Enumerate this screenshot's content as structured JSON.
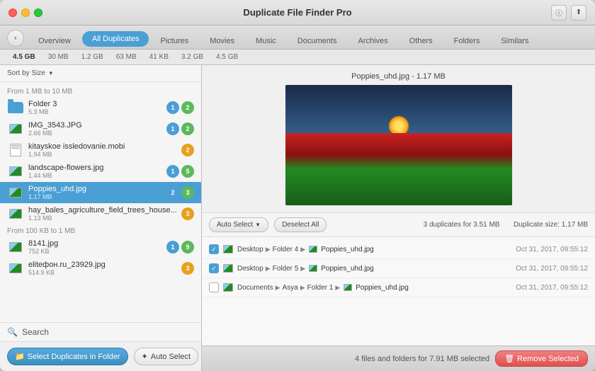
{
  "window": {
    "title": "Duplicate File Finder Pro"
  },
  "titlebar": {
    "back_btn": "‹",
    "info_btn": "ⓘ",
    "share_btn": "⬆"
  },
  "tabs": [
    {
      "id": "overview",
      "label": "Overview",
      "active": false
    },
    {
      "id": "all-duplicates",
      "label": "All Duplicates",
      "active": true
    },
    {
      "id": "pictures",
      "label": "Pictures",
      "active": false
    },
    {
      "id": "movies",
      "label": "Movies",
      "active": false
    },
    {
      "id": "music",
      "label": "Music",
      "active": false
    },
    {
      "id": "documents",
      "label": "Documents",
      "active": false
    },
    {
      "id": "archives",
      "label": "Archives",
      "active": false
    },
    {
      "id": "others",
      "label": "Others",
      "active": false
    },
    {
      "id": "folders",
      "label": "Folders",
      "active": false
    },
    {
      "id": "similars",
      "label": "Similars",
      "active": false
    }
  ],
  "subtabs": [
    {
      "label": "4.5 GB"
    },
    {
      "label": "30 MB"
    },
    {
      "label": "1.2 GB"
    },
    {
      "label": "63 MB"
    },
    {
      "label": "41 KB"
    },
    {
      "label": "3.2 GB"
    },
    {
      "label": "4.5 GB"
    }
  ],
  "sort_row": {
    "label": "Sort by Size",
    "arrow": "▼"
  },
  "section1_header": "From 1 MB to 10 MB",
  "file_items_section1": [
    {
      "name": "Folder 3",
      "size": "5.3 MB",
      "type": "folder",
      "badge1": "1",
      "badge2": "2"
    },
    {
      "name": "IMG_3543.JPG",
      "size": "2.66 MB",
      "type": "image",
      "badge1": "1",
      "badge2": "2"
    },
    {
      "name": "kitayskoe issledovanie.mobi",
      "size": "1.94 MB",
      "type": "doc",
      "badge1": "2",
      "badge2": null
    },
    {
      "name": "landscape-flowers.jpg",
      "size": "1.44 MB",
      "type": "image",
      "badge1": "1",
      "badge2": "5"
    },
    {
      "name": "Poppies_uhd.jpg",
      "size": "1.17 MB",
      "type": "image",
      "badge1": "2",
      "badge2": "3",
      "selected": true
    },
    {
      "name": "hay_bales_agriculture_field_trees_house...",
      "size": "1.13 MB",
      "type": "image",
      "badge1": "3",
      "badge2": null
    }
  ],
  "section2_header": "From 100 KB to 1 MB",
  "file_items_section2": [
    {
      "name": "8141.jpg",
      "size": "752 KB",
      "type": "image",
      "badge1": "1",
      "badge2": "9"
    },
    {
      "name": "elitефон.ru_23929.jpg",
      "size": "514.9 KB",
      "type": "image",
      "badge1": "3",
      "badge2": null
    }
  ],
  "search_label": "Search",
  "buttons": {
    "select_duplicates": "Select Duplicates in Folder",
    "auto_select": "Auto Select"
  },
  "preview": {
    "filename": "Poppies_uhd.jpg",
    "filesize": "1.17 MB",
    "title": "Poppies_uhd.jpg - 1.17 MB"
  },
  "actions": {
    "auto_select": "Auto Select",
    "deselect_all": "Deselect All",
    "duplicates_info": "3 duplicates for 3.51 MB",
    "duplicate_size": "Duplicate size: 1.17 MB"
  },
  "dup_rows": [
    {
      "checked": true,
      "path_parts": [
        "Desktop",
        "Folder 4"
      ],
      "filename": "Poppies_uhd.jpg",
      "date": "Oct 31, 2017, 09:55:12"
    },
    {
      "checked": true,
      "path_parts": [
        "Desktop",
        "Folder 5"
      ],
      "filename": "Poppies_uhd.jpg",
      "date": "Oct 31, 2017, 09:55:12"
    },
    {
      "checked": false,
      "path_parts": [
        "Documents",
        "Asya",
        "Folder 1"
      ],
      "filename": "Poppies_uhd.jpg",
      "date": "Oct 31, 2017, 09:55:12"
    }
  ],
  "status": {
    "text": "4 files and folders for 7.91 MB selected",
    "remove_btn": "Remove Selected",
    "trash_icon": "🗑"
  }
}
